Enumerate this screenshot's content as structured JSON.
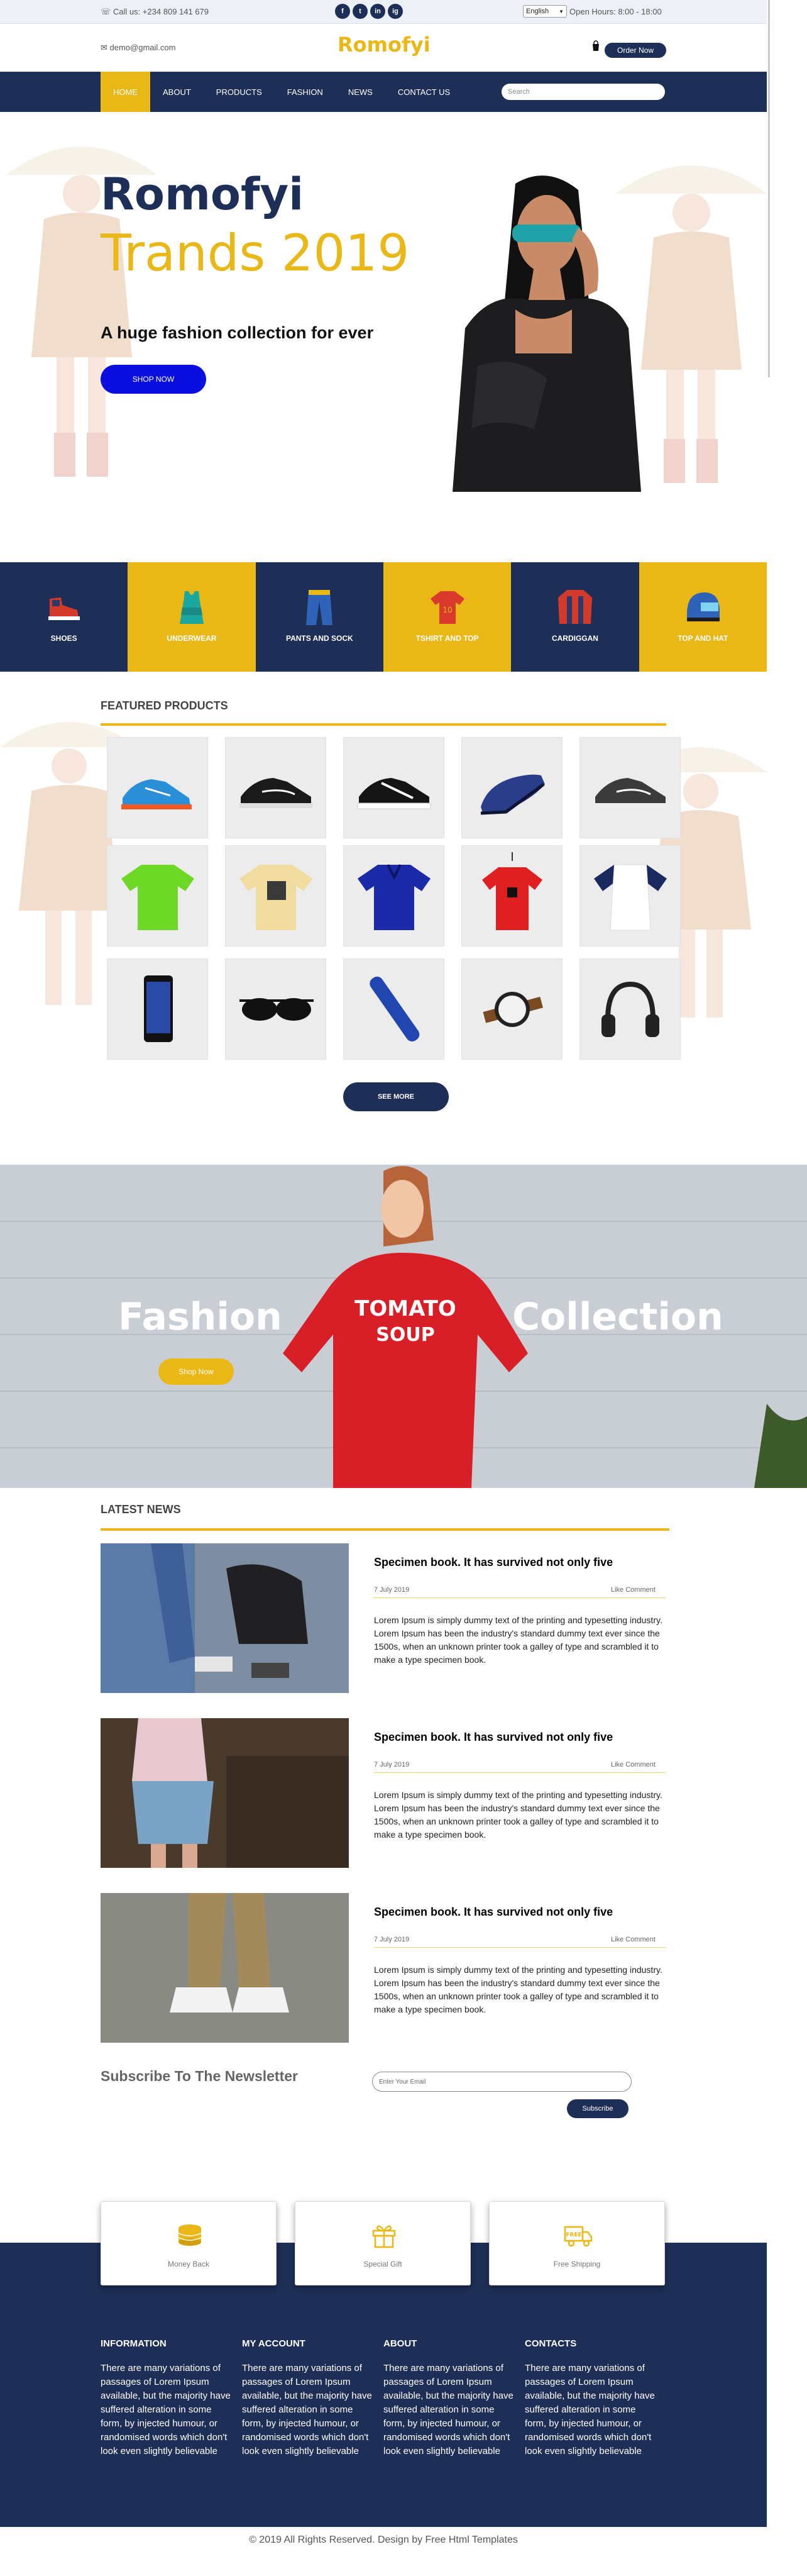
{
  "topbar": {
    "phone": "Call us: +234 809 141 679",
    "social": [
      "f",
      "t",
      "in",
      "ig"
    ],
    "language": "English",
    "hours": "Open Hours: 8:00 - 18:00"
  },
  "header": {
    "email": "demo@gmail.com",
    "logo": "Romofyi",
    "order_label": "Order Now"
  },
  "nav": {
    "items": [
      "HOME",
      "ABOUT",
      "PRODUCTS",
      "FASHION",
      "NEWS",
      "CONTACT US"
    ],
    "active": "HOME",
    "search_placeholder": "Search"
  },
  "hero": {
    "title1": "Romofyi",
    "title2": "Trands 2019",
    "subtitle": "A huge fashion collection for ever",
    "button": "SHOP NOW"
  },
  "categories": [
    {
      "label": "SHOES",
      "icon": "shoe-icon"
    },
    {
      "label": "UNDERWEAR",
      "icon": "tank-top-icon"
    },
    {
      "label": "PANTS AND SOCK",
      "icon": "pants-icon"
    },
    {
      "label": "TSHIRT AND TOP",
      "icon": "tshirt-icon"
    },
    {
      "label": "CARDIGGAN",
      "icon": "cardigan-icon"
    },
    {
      "label": "TOP AND HAT",
      "icon": "helmet-icon"
    }
  ],
  "featured": {
    "title": "FEATURED PRODUCTS",
    "products": [
      "blue-sneaker",
      "black-sneaker",
      "black-white-sneaker",
      "navy-dress-shoe",
      "gray-sneaker",
      "green-tshirt",
      "beige-print-tshirt",
      "navy-polo",
      "red-tshirt",
      "raglan-tshirt",
      "smartphone",
      "sunglasses",
      "hair-trimmer",
      "wristwatch",
      "headphones"
    ],
    "see_more": "SEE MORE"
  },
  "banner": {
    "word_left": "Fashion",
    "word_right": "Collection",
    "button": "Shop Now",
    "sweater_text1": "TOMATO",
    "sweater_text2": "SOUP"
  },
  "news": {
    "title": "LATEST NEWS",
    "items": [
      {
        "title": "Specimen book. It has survived not only five",
        "date": "7 July 2019",
        "like": "Like Comment",
        "body": "Lorem Ipsum is simply dummy text of the printing and typesetting industry. Lorem Ipsum has been the industry's standard dummy text ever since the 1500s, when an unknown printer took a galley of type and scrambled it to make a type specimen book."
      },
      {
        "title": "Specimen book. It has survived not only five",
        "date": "7 July 2019",
        "like": "Like Comment",
        "body": "Lorem Ipsum is simply dummy text of the printing and typesetting industry. Lorem Ipsum has been the industry's standard dummy text ever since the 1500s, when an unknown printer took a galley of type and scrambled it to make a type specimen book."
      },
      {
        "title": "Specimen book. It has survived not only five",
        "date": "7 July 2019",
        "like": "Like Comment",
        "body": "Lorem Ipsum is simply dummy text of the printing and typesetting industry. Lorem Ipsum has been the industry's standard dummy text ever since the 1500s, when an unknown printer took a galley of type and scrambled it to make a type specimen book."
      }
    ]
  },
  "newsletter": {
    "title": "Subscribe To The Newsletter",
    "placeholder": "Enter Your Email",
    "button": "Subscribe"
  },
  "features": [
    {
      "label": "Money Back",
      "icon": "coins-icon"
    },
    {
      "label": "Special Gift",
      "icon": "gift-icon"
    },
    {
      "label": "Free Shipping",
      "icon": "truck-icon"
    }
  ],
  "footer": {
    "columns": [
      {
        "title": "INFORMATION",
        "text": "There are many variations of passages of Lorem Ipsum available, but the majority have suffered alteration in some form, by injected humour, or randomised words which don't look even slightly believable"
      },
      {
        "title": "MY ACCOUNT",
        "text": "There are many variations of passages of Lorem Ipsum available, but the majority have suffered alteration in some form, by injected humour, or randomised words which don't look even slightly believable"
      },
      {
        "title": "ABOUT",
        "text": "There are many variations of passages of Lorem Ipsum available, but the majority have suffered alteration in some form, by injected humour, or randomised words which don't look even slightly believable"
      },
      {
        "title": "CONTACTS",
        "text": "There are many variations of passages of Lorem Ipsum available, but the majority have suffered alteration in some form, by injected humour, or randomised words which don't look even slightly believable"
      }
    ],
    "copyright": "© 2019 All Rights Reserved. Design by Free Html Templates"
  },
  "colors": {
    "navy": "#1e2f57",
    "yellow": "#e9b716",
    "blue_button": "#0a0fe0"
  }
}
